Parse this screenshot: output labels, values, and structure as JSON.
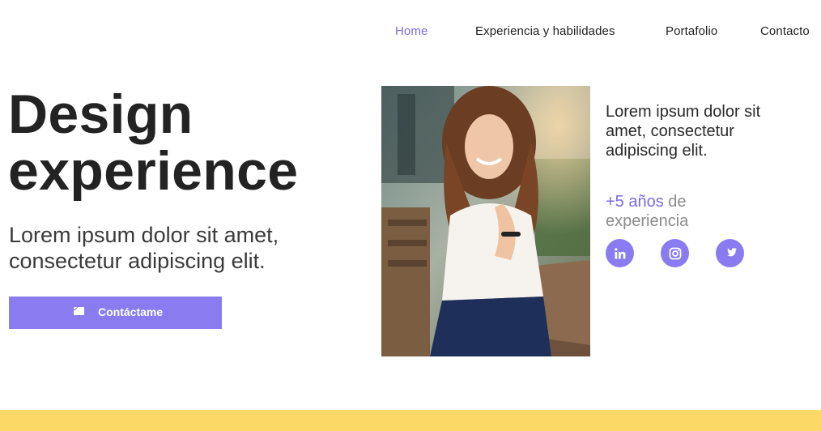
{
  "nav": {
    "items": [
      {
        "label": "Home",
        "active": true
      },
      {
        "label": "Experiencia y habilidades",
        "active": false
      },
      {
        "label": "Portafolio",
        "active": false
      },
      {
        "label": "Contacto",
        "active": false
      }
    ]
  },
  "hero": {
    "title_line1": "Design",
    "title_line2": "experience",
    "subtitle": "Lorem ipsum dolor sit amet, consectetur adipiscing elit.",
    "cta_label": "Contáctame",
    "cta_icon": "mail-icon"
  },
  "side": {
    "text": "Lorem ipsum dolor sit amet, consectetur adipiscing elit.",
    "years_highlight": "+5 años",
    "years_rest": " de experiencia"
  },
  "social": [
    {
      "icon": "linkedin-icon"
    },
    {
      "icon": "instagram-icon"
    },
    {
      "icon": "twitter-icon"
    }
  ],
  "colors": {
    "accent": "#8a7cf0",
    "accent_text": "#7b6ae6",
    "footer_band": "#fcd967"
  }
}
